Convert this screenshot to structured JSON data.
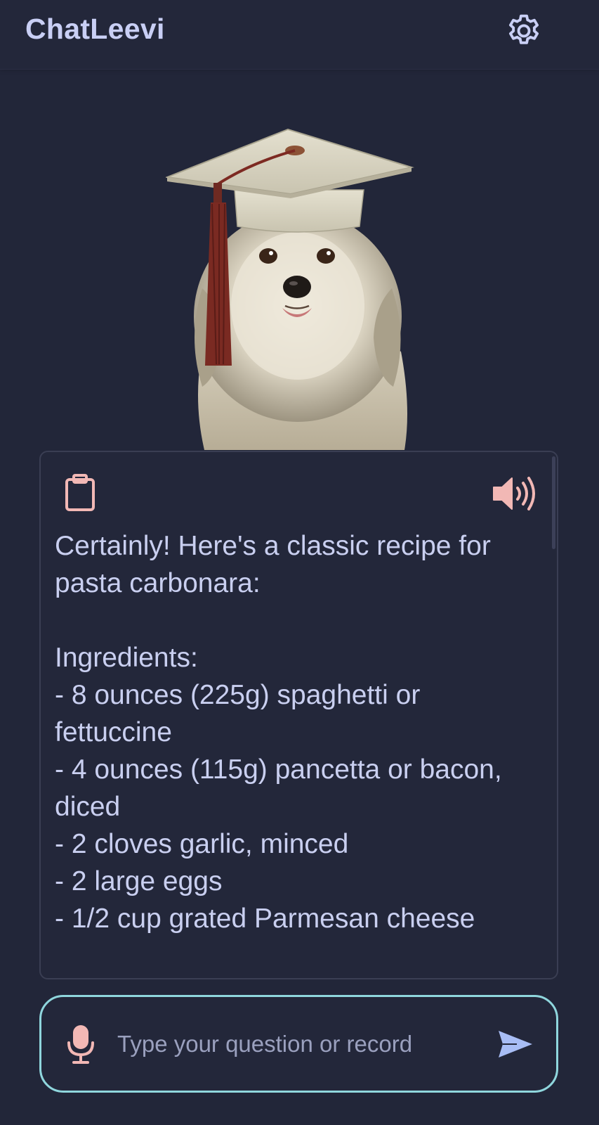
{
  "header": {
    "title": "ChatLeevi",
    "settings_icon": "gear-icon"
  },
  "avatar": {
    "icon": "dog-with-graduation-cap"
  },
  "message": {
    "copy_icon": "clipboard-icon",
    "speak_icon": "speaker-icon",
    "text": "Certainly! Here's a classic recipe for pasta carbonara:\n\nIngredients:\n- 8 ounces (225g) spaghetti or fettuccine\n- 4 ounces (115g) pancetta or bacon, diced\n- 2 cloves garlic, minced\n- 2 large eggs\n- 1/2 cup grated Parmesan cheese"
  },
  "input": {
    "value": "",
    "placeholder": "Type your question or record",
    "mic_icon": "microphone-icon",
    "send_icon": "send-icon"
  },
  "colors": {
    "background": "#222639",
    "accent_pink": "#f2b8b5",
    "accent_blue": "#a8bdf5",
    "input_border": "#8fd6dd",
    "text": "#c9cff0"
  }
}
